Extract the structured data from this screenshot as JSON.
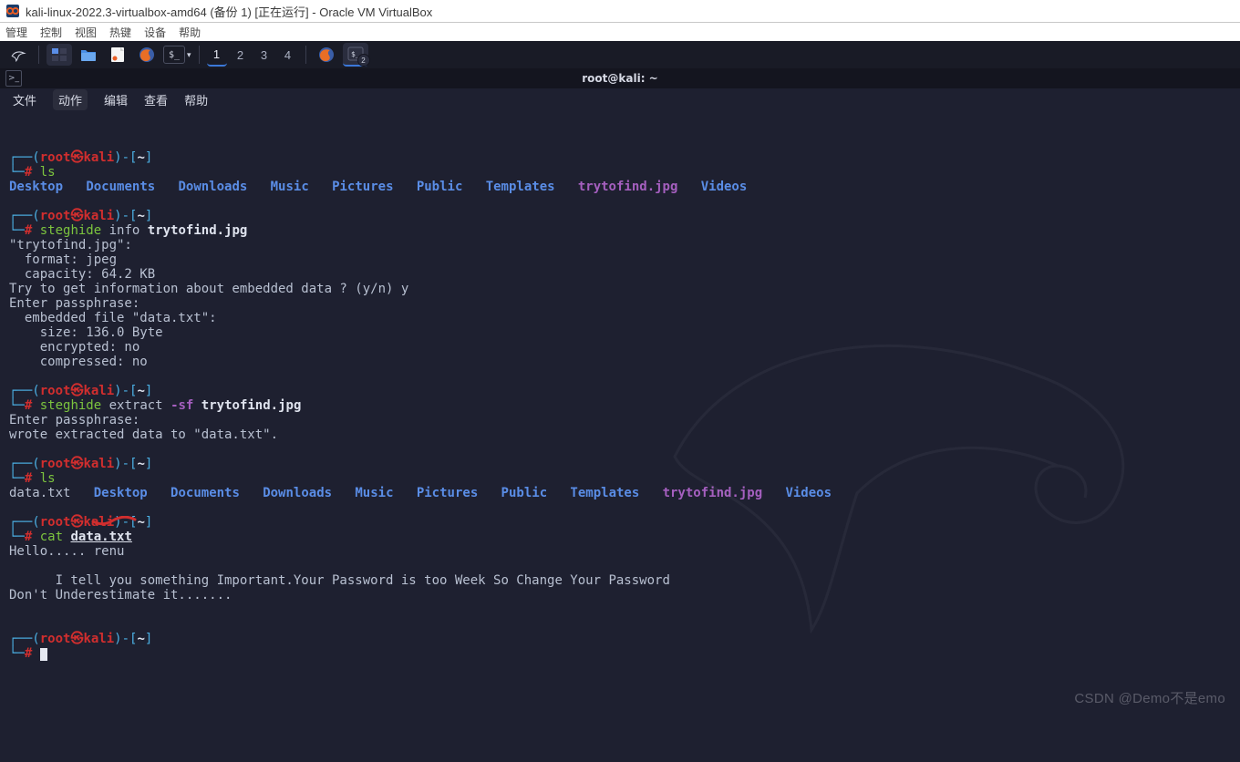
{
  "vb": {
    "title": "kali-linux-2022.3-virtualbox-amd64 (备份 1) [正在运行] - Oracle VM VirtualBox",
    "menu": [
      "管理",
      "控制",
      "视图",
      "热键",
      "设备",
      "帮助"
    ]
  },
  "taskbar": {
    "icons": [
      "kali-menu",
      "window-list",
      "files",
      "text-editor",
      "firefox",
      "terminal"
    ],
    "workspaces": [
      "1",
      "2",
      "3",
      "4"
    ]
  },
  "term": {
    "window_title": "root@kali: ~",
    "menu": [
      "文件",
      "动作",
      "编辑",
      "查看",
      "帮助"
    ]
  },
  "prompt": {
    "open": "┌──(",
    "user": "root",
    "at": "㉿",
    "host": "kali",
    "close_user": ")-[",
    "path": "~",
    "close": "]",
    "l2": "└─",
    "hash": "#"
  },
  "sessions": {
    "s1": {
      "cmd": "ls",
      "out_dirs": [
        "Desktop",
        "Documents",
        "Downloads",
        "Music",
        "Pictures",
        "Public",
        "Templates"
      ],
      "out_file": "trytofind.jpg",
      "out_dirs2": [
        "Videos"
      ]
    },
    "s2": {
      "cmd1": "steghide",
      "cmd2": "info",
      "arg": "trytofind.jpg",
      "lines": [
        "\"trytofind.jpg\":",
        "  format: jpeg",
        "  capacity: 64.2 KB",
        "Try to get information about embedded data ? (y/n) y",
        "Enter passphrase:",
        "  embedded file \"data.txt\":",
        "    size: 136.0 Byte",
        "    encrypted: no",
        "    compressed: no"
      ]
    },
    "s3": {
      "cmd1": "steghide",
      "cmd2": "extract",
      "flag": "-sf",
      "arg": "trytofind.jpg",
      "lines": [
        "Enter passphrase:",
        "wrote extracted data to \"data.txt\"."
      ]
    },
    "s4": {
      "cmd": "ls",
      "out_plain": "data.txt",
      "out_dirs": [
        "Desktop",
        "Documents",
        "Downloads",
        "Music",
        "Pictures",
        "Public",
        "Templates"
      ],
      "out_file": "trytofind.jpg",
      "out_dirs2": [
        "Videos"
      ]
    },
    "s5": {
      "cmd": "cat",
      "arg": "data.txt",
      "lines": [
        "Hello..... renu",
        "",
        "      I tell you something Important.Your Password is too Week So Change Your Password",
        "Don't Underestimate it......."
      ]
    }
  },
  "watermark": "CSDN @Demo不是emo"
}
